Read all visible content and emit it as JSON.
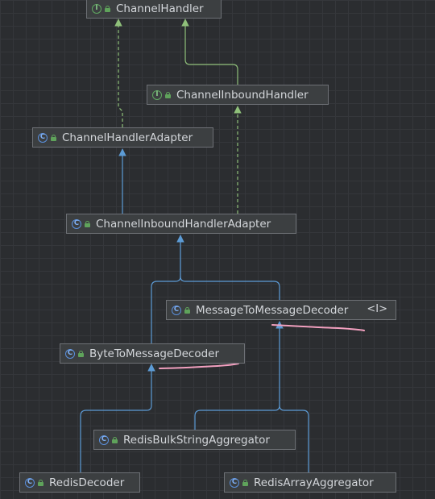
{
  "nodes": {
    "channel_handler": {
      "label": "ChannelHandler",
      "kind": "I"
    },
    "channel_inbound_handler": {
      "label": "ChannelInboundHandler",
      "kind": "I"
    },
    "channel_handler_adapter": {
      "label": "ChannelHandlerAdapter",
      "kind": "C"
    },
    "channel_inbound_handler_adapter": {
      "label": "ChannelInboundHandlerAdapter",
      "kind": "C"
    },
    "message_to_message_decoder": {
      "label": "MessageToMessageDecoder",
      "kind": "C",
      "badge": "<I>"
    },
    "byte_to_message_decoder": {
      "label": "ByteToMessageDecoder",
      "kind": "C"
    },
    "redis_bulk_string_aggregator": {
      "label": "RedisBulkStringAggregator",
      "kind": "C"
    },
    "redis_decoder": {
      "label": "RedisDecoder",
      "kind": "C"
    },
    "redis_array_aggregator": {
      "label": "RedisArrayAggregator",
      "kind": "C"
    }
  },
  "colors": {
    "background": "#2b2d30",
    "extends_edge": "#5c9bd5",
    "implements_edge": "#8fc07a",
    "annotation_stroke": "#f2a0bf"
  }
}
